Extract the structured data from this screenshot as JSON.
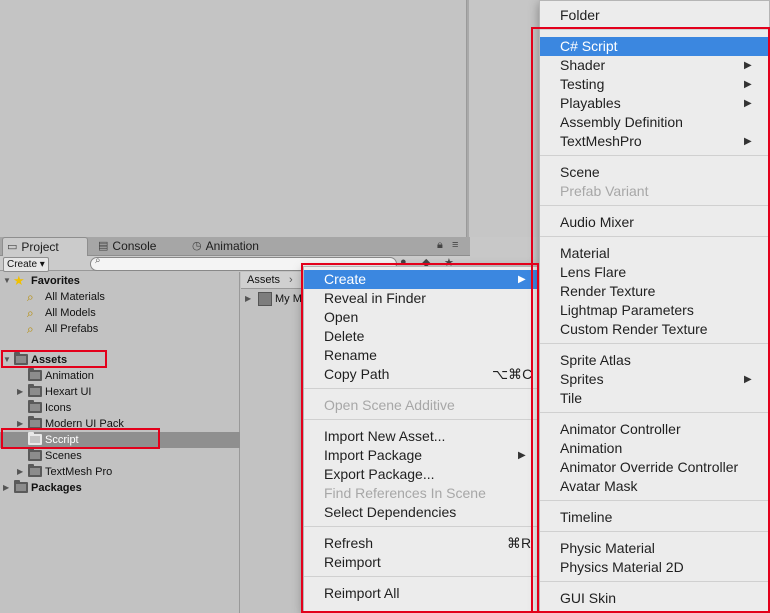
{
  "tabs": [
    {
      "label": "Project",
      "icon": "folder-icon"
    },
    {
      "label": "Console",
      "icon": "console-icon"
    },
    {
      "label": "Animation",
      "icon": "animation-clock-icon"
    }
  ],
  "toolbar": {
    "create_label": "Create ▾",
    "search_placeholder": ""
  },
  "tree": {
    "favorites": {
      "label": "Favorites",
      "items": [
        "All Materials",
        "All Models",
        "All Prefabs"
      ]
    },
    "assets": {
      "label": "Assets",
      "items": [
        "Animation",
        "Hexart UI",
        "Icons",
        "Modern UI Pack",
        "Sccript",
        "Scenes",
        "TextMesh Pro"
      ]
    },
    "packages": {
      "label": "Packages"
    }
  },
  "assets_panel": {
    "breadcrumb": "Assets",
    "item": "My M"
  },
  "context_menu": {
    "create": "Create",
    "reveal": "Reveal in Finder",
    "open": "Open",
    "delete": "Delete",
    "rename": "Rename",
    "copy_path": "Copy Path",
    "copy_path_shortcut": "⌥⌘C",
    "open_scene_additive": "Open Scene Additive",
    "import_new_asset": "Import New Asset...",
    "import_package": "Import Package",
    "export_package": "Export Package...",
    "find_references": "Find References In Scene",
    "select_dependencies": "Select Dependencies",
    "refresh": "Refresh",
    "refresh_shortcut": "⌘R",
    "reimport": "Reimport",
    "reimport_all": "Reimport All"
  },
  "create_submenu": {
    "folder": "Folder",
    "csharp_script": "C# Script",
    "shader": "Shader",
    "testing": "Testing",
    "playables": "Playables",
    "assembly_definition": "Assembly Definition",
    "textmeshpro": "TextMeshPro",
    "scene": "Scene",
    "prefab_variant": "Prefab Variant",
    "audio_mixer": "Audio Mixer",
    "material": "Material",
    "lens_flare": "Lens Flare",
    "render_texture": "Render Texture",
    "lightmap_parameters": "Lightmap Parameters",
    "custom_render_texture": "Custom Render Texture",
    "sprite_atlas": "Sprite Atlas",
    "sprites": "Sprites",
    "tile": "Tile",
    "animator_controller": "Animator Controller",
    "animation": "Animation",
    "animator_override_controller": "Animator Override Controller",
    "avatar_mask": "Avatar Mask",
    "timeline": "Timeline",
    "physic_material": "Physic Material",
    "physics_material_2d": "Physics Material 2D",
    "gui_skin": "GUI Skin"
  },
  "colors": {
    "highlight": "#3b87e0",
    "annotation": "#e3001b"
  }
}
